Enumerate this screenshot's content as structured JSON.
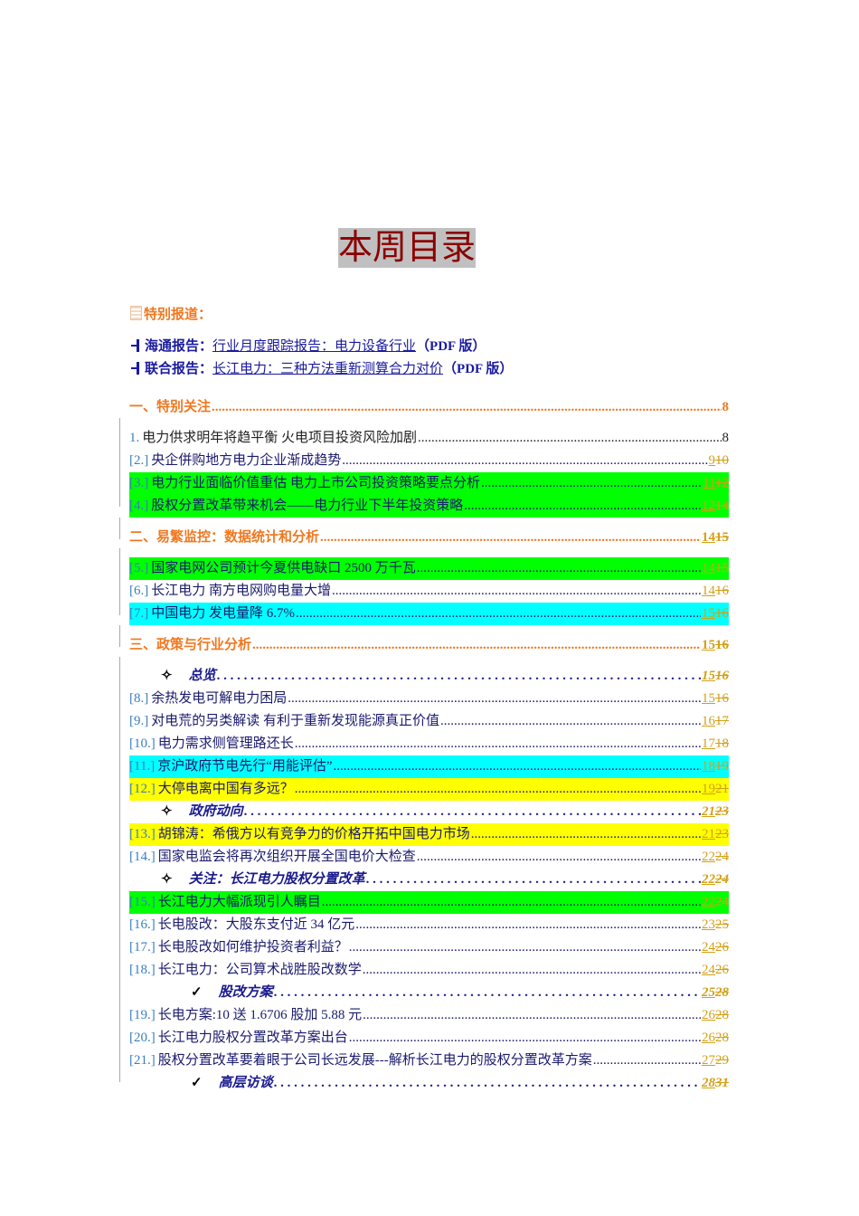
{
  "title": "本周目录",
  "special": {
    "label": "特别报道：",
    "reports": [
      {
        "source": "海通报告：",
        "link": "行业月度跟踪报告：电力设备行业",
        "suffix": "（PDF 版）"
      },
      {
        "source": "联合报告：",
        "link": "长江电力：三种方法重新测算合力对价",
        "suffix": "（PDF 版）"
      }
    ]
  },
  "toc": [
    {
      "type": "sec",
      "text": "一、特别关注",
      "page": "8"
    },
    {
      "type": "plain",
      "num": "1.",
      "text": "电力供求明年将趋平衡  火电项目投资风险加剧",
      "page": "8"
    },
    {
      "type": "item",
      "num": "[2.]",
      "text": "央企併购地方电力企业渐成趋势",
      "ins": "9",
      "del": "10"
    },
    {
      "type": "item",
      "num": "[3.]",
      "text": "电力行业面临价值重估  电力上市公司投资策略要点分析",
      "ins": "11",
      "del": "12",
      "hl": "green"
    },
    {
      "type": "item",
      "num": "[4.]",
      "text": "股权分置改革带来机会——电力行业下半年投资策略",
      "ins": "12",
      "del": "14",
      "hl": "green"
    },
    {
      "type": "sec",
      "text": "二、易繁监控：数据统计和分析",
      "ins": "14",
      "del": "15"
    },
    {
      "type": "item",
      "num": "[5.]",
      "text": "国家电网公司预计今夏供电缺口 2500 万千瓦",
      "ins": "14",
      "del": "15",
      "hl": "green"
    },
    {
      "type": "item",
      "num": "[6.]",
      "text": "长江电力  南方电网购电量大增",
      "ins": "14",
      "del": "16"
    },
    {
      "type": "item",
      "num": "[7.]",
      "text": "中国电力  发电量降 6.7%",
      "ins": "15",
      "del": "16",
      "hl": "cyan"
    },
    {
      "type": "sec",
      "text": "三、政策与行业分析",
      "ins": "15",
      "del": "16"
    },
    {
      "type": "sub",
      "bullet": "✧",
      "text": "总览",
      "ins": "15",
      "del": "16"
    },
    {
      "type": "item",
      "num": "[8.]",
      "text": "余热发电可解电力困局",
      "ins": "15",
      "del": "16"
    },
    {
      "type": "item",
      "num": "[9.]",
      "text": "对电荒的另类解读  有利于重新发现能源真正价值",
      "ins": "16",
      "del": "17"
    },
    {
      "type": "item",
      "num": "[10.]",
      "text": "电力需求侧管理路还长",
      "ins": "17",
      "del": "18"
    },
    {
      "type": "item",
      "num": "[11.]",
      "text": "京沪政府节电先行“用能评估” ",
      "ins": "18",
      "del": "19",
      "hl": "cyan"
    },
    {
      "type": "item",
      "num": "[12.]",
      "text": "大停电离中国有多远？ ",
      "ins": "19",
      "del": "21",
      "hl": "yellow"
    },
    {
      "type": "sub",
      "bullet": "✧",
      "text": "政府动向",
      "ins": "21",
      "del": "23"
    },
    {
      "type": "item",
      "num": "[13.]",
      "text": "胡锦涛：希俄方以有竞争力的价格开拓中国电力市场",
      "ins": "21",
      "del": "23",
      "hl": "yellow"
    },
    {
      "type": "item",
      "num": "[14.]",
      "text": "国家电监会将再次组织开展全国电价大检查",
      "ins": "22",
      "del": "24"
    },
    {
      "type": "sub",
      "bullet": "✧",
      "text": "关注：长江电力股权分置改革",
      "ins": "22",
      "del": "24"
    },
    {
      "type": "item",
      "num": "[15.]",
      "text": "长江电力大幅派现引人瞩目",
      "ins": "22",
      "del": "24",
      "hl": "green"
    },
    {
      "type": "item",
      "num": "[16.]",
      "text": "长电股改：大股东支付近 34 亿元",
      "ins": "23",
      "del": "25"
    },
    {
      "type": "item",
      "num": "[17.]",
      "text": "长电股改如何维护投资者利益？ ",
      "ins": "24",
      "del": "26"
    },
    {
      "type": "item",
      "num": "[18.]",
      "text": "长江电力：公司算术战胜股改数学",
      "ins": "24",
      "del": "26"
    },
    {
      "type": "sub2",
      "bullet": "✓",
      "text": "股改方案",
      "ins": "25",
      "del": "28"
    },
    {
      "type": "item",
      "num": "[19.]",
      "text": "长电方案:10 送 1.6706 股加 5.88 元",
      "ins": "26",
      "del": "28"
    },
    {
      "type": "item",
      "num": "[20.]",
      "text": "长江电力股权分置改革方案出台",
      "ins": "26",
      "del": "28"
    },
    {
      "type": "item",
      "num": "[21.]",
      "text": "股权分置改革要着眼于公司长远发展---解析长江电力的股权分置改革方案",
      "ins": "27",
      "del": "29"
    },
    {
      "type": "sub2",
      "bullet": "✓",
      "text": "高层访谈",
      "ins": "28",
      "del": "31"
    }
  ],
  "colors": {
    "section": "#f07820",
    "green": "#00ff00",
    "cyan": "#00ffff",
    "yellow": "#ffff00",
    "title": "#8b0000"
  }
}
